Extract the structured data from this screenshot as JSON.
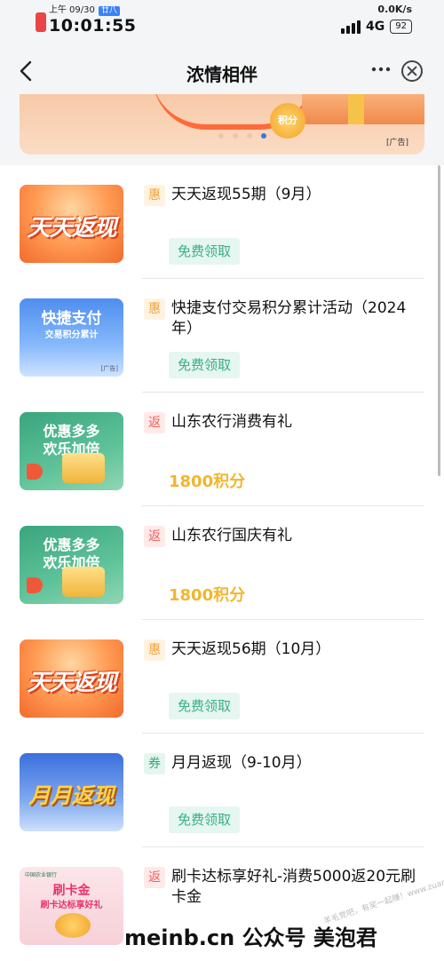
{
  "status_bar": {
    "period": "上午",
    "date": "09/30",
    "lunar": "廿八",
    "time": "10:01:55",
    "net_speed": "0.0K/s",
    "network": "4G",
    "battery": "92"
  },
  "nav": {
    "back_icon": "chevron-left-icon",
    "title": "浓情相伴",
    "more_icon": "more-dots-icon",
    "close_icon": "close-circle-icon"
  },
  "banner": {
    "coin_text": "积分",
    "ad_label": "[广告]",
    "dot_count": 4,
    "active_dot": 4
  },
  "items": [
    {
      "thumb_text": "天天返现",
      "tag": "惠",
      "title": "天天返现55期（9月）",
      "action": "免费领取"
    },
    {
      "thumb_text_1": "快捷支付",
      "thumb_text_2": "交易积分累计",
      "thumb_text_3": "[广告]",
      "tag": "惠",
      "title": "快捷支付交易积分累计活动（2024年）",
      "action": "免费领取"
    },
    {
      "thumb_text_1": "优惠多多",
      "thumb_text_2": "欢乐加倍",
      "tag": "返",
      "title": "山东农行消费有礼",
      "points": "1800积分"
    },
    {
      "thumb_text_1": "优惠多多",
      "thumb_text_2": "欢乐加倍",
      "tag": "返",
      "title": "山东农行国庆有礼",
      "points": "1800积分"
    },
    {
      "thumb_text": "天天返现",
      "tag": "惠",
      "title": "天天返现56期（10月）",
      "action": "免费领取"
    },
    {
      "thumb_text": "月月返现",
      "tag": "券",
      "title": "月月返现（9-10月）",
      "action": "免费领取"
    },
    {
      "thumb_text_0": "中国农业银行",
      "thumb_text_1": "刷卡金",
      "thumb_text_2": "刷卡达标享好礼",
      "tag": "返",
      "title": "刷卡达标享好礼-消费5000返20元刷卡金"
    }
  ],
  "watermark": {
    "text": "meinb.cn 公众号 美泡君",
    "faint_text": "羊毛党吧，有奖一起赚！www.zuanke8.com"
  },
  "colors": {
    "accent_green": "#3aae87",
    "points_gold": "#f2b62d",
    "tag_hui": "#f0a03a",
    "tag_fan": "#f0605a",
    "tag_quan": "#3aa57d"
  }
}
